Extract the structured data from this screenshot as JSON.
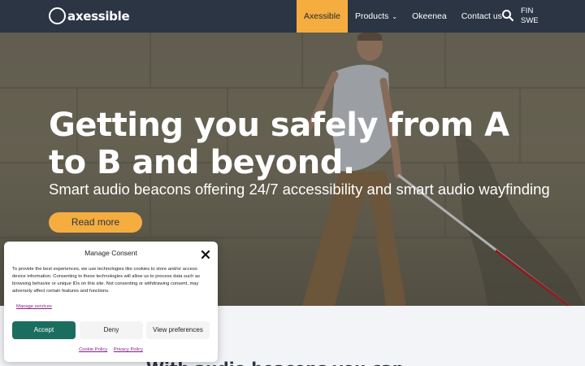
{
  "header": {
    "logo_text": "axessible",
    "nav": [
      {
        "label": "Axessible",
        "active": true
      },
      {
        "label": "Products",
        "dropdown": true
      },
      {
        "label": "Okeenea"
      },
      {
        "label": "Contact us"
      }
    ],
    "search_icon": "search-icon",
    "languages": [
      "FIN",
      "SWE"
    ]
  },
  "hero": {
    "title": "Getting you safely from A to B and beyond.",
    "subtitle": "Smart audio beacons offering 24/7 accessibility and smart audio wayfinding",
    "cta_label": "Read more"
  },
  "below": {
    "partial_heading": "With audio beacons you can"
  },
  "consent": {
    "title": "Manage Consent",
    "body": "To provide the best experiences, we use technologies like cookies to store and/or access device information. Consenting to these technologies will allow us to process data such as browsing behavior or unique IDs on this site. Not consenting or withdrawing consent, may adversely affect certain features and functions.",
    "manage_link": "Manage services",
    "accept_label": "Accept",
    "deny_label": "Deny",
    "preferences_label": "View preferences",
    "cookie_policy": "Cookie Policy",
    "privacy_policy": "Privacy Policy"
  },
  "colors": {
    "header_bg": "#2b3544",
    "accent": "#f5ad3f",
    "accept_bg": "#1b6e5f",
    "link": "#8a1a8c"
  }
}
